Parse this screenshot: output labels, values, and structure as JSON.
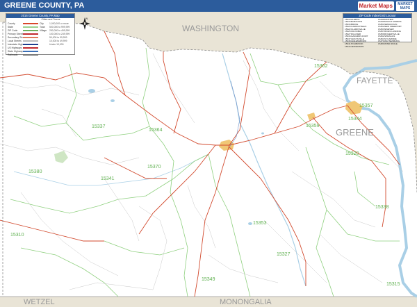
{
  "header": {
    "title": "GREENE COUNTY, PA",
    "brand_logo": "Market Maps",
    "brand_badge": "MARKET MAPS"
  },
  "legend": {
    "title": "2016 Greene County, PA Map",
    "subtitle": "Cities and Towns",
    "rows": [
      {
        "label": "County",
        "swatch": "#d9472b",
        "value": "City",
        "pop": "1,000,000 or more"
      },
      {
        "label": "State",
        "swatch": "#9ad18d",
        "value": "Town",
        "pop": "500,000 to 999,999"
      },
      {
        "label": "ZIP Code",
        "swatch": "#6fae5c",
        "value": "Village",
        "pop": "250,000 to 499,999"
      },
      {
        "label": "Primary Streets",
        "swatch": "#c0282d",
        "value": "",
        "pop": "100,000 to 249,999"
      },
      {
        "label": "Secondary Streets",
        "swatch": "#e07b5a",
        "value": "",
        "pop": "50,000 to 99,999"
      },
      {
        "label": "Local Streets",
        "swatch": "#bbbbbb",
        "value": "",
        "pop": "10,000 to 49,999"
      },
      {
        "label": "Interstate Highways",
        "swatch": "#1f3f8f",
        "value": "",
        "pop": "Under 10,000"
      },
      {
        "label": "US Highways",
        "swatch": "#c0282d",
        "value": "",
        "pop": ""
      },
      {
        "label": "State Highways",
        "swatch": "#3b6fb6",
        "value": "",
        "pop": ""
      },
      {
        "label": "Railroads",
        "swatch": "#777777",
        "value": "",
        "pop": ""
      }
    ]
  },
  "zip_index": {
    "title": "ZIP Code Index/Grid Locator",
    "col1": [
      {
        "zip": "15310",
        "name": "ALEPPO"
      },
      {
        "zip": "15315",
        "name": "BOBTOWN"
      },
      {
        "zip": "15316",
        "name": "BRAVE"
      },
      {
        "zip": "15320",
        "name": "CARMICHAELS"
      },
      {
        "zip": "15322",
        "name": "CLARKSVILLE"
      },
      {
        "zip": "15325",
        "name": "CRUCIBLE"
      },
      {
        "zip": "15327",
        "name": "DILLINER"
      },
      {
        "zip": "15334",
        "name": "GARARDS FORT"
      },
      {
        "zip": "15337",
        "name": "GRAYSVILLE"
      },
      {
        "zip": "15338",
        "name": "GREENSBORO"
      },
      {
        "zip": "15341",
        "name": "HOLBROOK"
      },
      {
        "zip": "15344",
        "name": "JEFFERSON"
      }
    ],
    "col2": [
      {
        "zip": "15346",
        "name": "MATHER"
      },
      {
        "zip": "15349",
        "name": "MOUNT MORRIS"
      },
      {
        "zip": "15351",
        "name": "NEMACOLIN"
      },
      {
        "zip": "15352",
        "name": "NEW FREEPORT"
      },
      {
        "zip": "15353",
        "name": "NINEVEH"
      },
      {
        "zip": "15357",
        "name": "RICES LANDING"
      },
      {
        "zip": "15359",
        "name": "ROGERSVILLE"
      },
      {
        "zip": "15362",
        "name": "SPRAGGS"
      },
      {
        "zip": "15364",
        "name": "SYCAMORE"
      },
      {
        "zip": "15370",
        "name": "WAYNESBURG"
      },
      {
        "zip": "15380",
        "name": "WIND RIDGE"
      }
    ]
  },
  "map": {
    "neighbors": {
      "north": "WASHINGTON",
      "east": "FAYETTE",
      "southwest": "WETZEL",
      "south": "MONONGALIA"
    },
    "county_label": "GREENE",
    "zip_labels": [
      "15362",
      "15337",
      "15364",
      "15359",
      "15357",
      "15344",
      "15320",
      "15380",
      "15341",
      "15310",
      "15370",
      "15338",
      "15353",
      "15349",
      "15327",
      "15315"
    ],
    "colors": {
      "land": "#ffffff",
      "outside": "#e9e4d6",
      "river": "#a9cfe6",
      "zip_boundary": "#8fd07f",
      "primary_road": "#d24a2e",
      "urban": "#f0c775",
      "label": "#999999",
      "zip_label": "#5fb04f"
    }
  },
  "compass": {
    "label": "N"
  }
}
